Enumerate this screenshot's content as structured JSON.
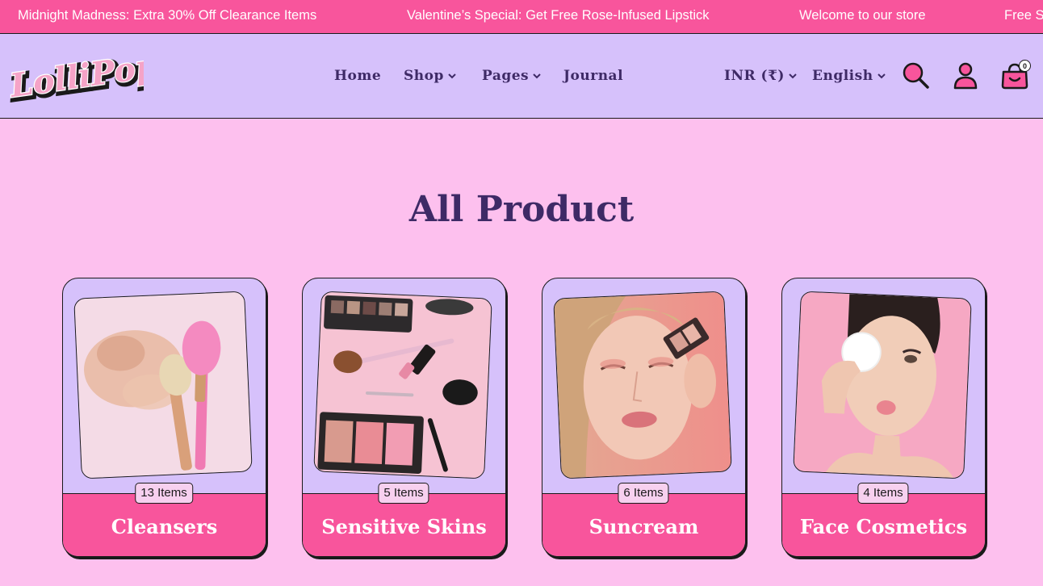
{
  "announcements": [
    "Midnight Madness: Extra 30% Off Clearance Items",
    "Valentine’s Special: Get Free Rose-Infused Lipstick",
    "Welcome to our store",
    "Free S"
  ],
  "brand": {
    "logo_text": "LolliPop"
  },
  "nav": {
    "home": "Home",
    "shop": "Shop",
    "pages": "Pages",
    "journal": "Journal"
  },
  "header_controls": {
    "currency": "INR (₹)",
    "language": "English",
    "cart_count": "0"
  },
  "icons": {
    "search": "search-icon",
    "account": "user-icon",
    "cart": "shopping-bag-icon",
    "dropdown": "chevron-down-icon"
  },
  "page": {
    "title": "All Product"
  },
  "categories": [
    {
      "name": "Cleansers",
      "count": "13 Items"
    },
    {
      "name": "Sensitive Skins",
      "count": "5 Items"
    },
    {
      "name": "Suncream",
      "count": "6 Items"
    },
    {
      "name": "Face Cosmetics",
      "count": "4 Items"
    }
  ],
  "colors": {
    "pink_accent": "#f8559c",
    "lavender": "#d6c1fb",
    "background": "#fdc0ee",
    "heading": "#3e2a66"
  }
}
